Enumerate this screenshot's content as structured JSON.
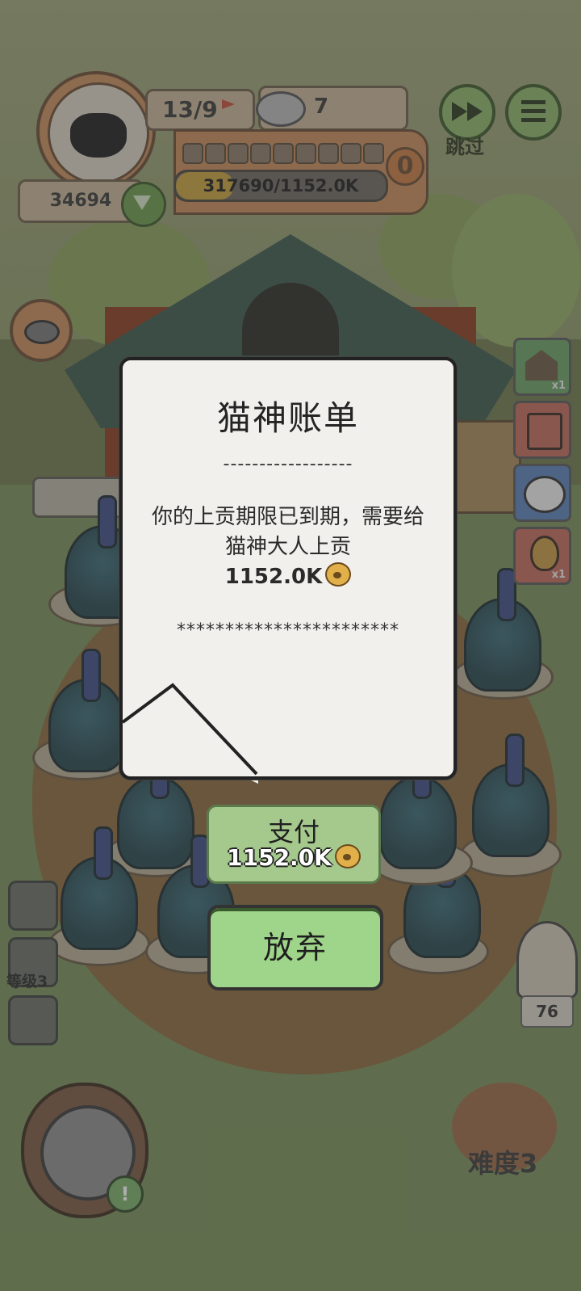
{
  "hud": {
    "level_progress": "13/9",
    "food_count": "7",
    "coins": "34694",
    "progress_text": "317690/1152.0K",
    "progress_fraction": 0.276,
    "zero_badge": "0",
    "skip_label": "跳过",
    "segments": 9
  },
  "side_cards": [
    {
      "icon": "barn-icon",
      "count": "x1",
      "color": "#6aa067"
    },
    {
      "icon": "tools-icon",
      "count": "",
      "color": "#c16b5b"
    },
    {
      "icon": "sheep-icon",
      "count": "",
      "color": "#5b82b8"
    },
    {
      "icon": "egg-icon",
      "count": "x1",
      "color": "#c16b5b"
    }
  ],
  "left_slots": {
    "level_label": "等级3"
  },
  "right_bottom": {
    "count": "76",
    "difficulty_label": "难度3"
  },
  "dialog": {
    "title": "猫神账单",
    "divider_top": "------------------",
    "message": "你的上贡期限已到期，需要给猫神大人上贡",
    "amount": "1152.0K",
    "divider_bottom": "***********************"
  },
  "buttons": {
    "pay_label": "支付",
    "pay_amount": "1152.0K",
    "give_up_label": "放弃"
  },
  "colors": {
    "dialog_bg": "#f1f0ec",
    "pay_button": "#a5c98d",
    "give_up_button": "#9fd58a",
    "paw_coin": "#e2b04a"
  }
}
